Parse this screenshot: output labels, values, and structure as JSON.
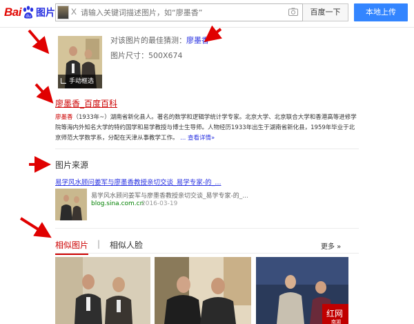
{
  "header": {
    "logo_bai": "Bai",
    "logo_tupian": "图片",
    "thumb_close": "X",
    "search_placeholder": "请输入关键词描述图片，如“廖墨香”",
    "search_button": "百度一下",
    "upload_button": "本地上传"
  },
  "guess": {
    "label": "对该图片的最佳猜测：",
    "keyword": "廖墨香",
    "size_label": "图片尺寸：500X674",
    "crop_label": "手动框选"
  },
  "baike": {
    "title": "廖墨香_百度百科",
    "desc_name": "廖墨香",
    "desc_body": "（1933年~）湖南省新化县人。著名的数学和逻辑学统计学专家。北京大学、北京联合大学和香港高等进修学院等海内外知名大学的特约国学和易学教授与博士生导师。人物经历1933年出生于湖南省新化县，1959年毕业于北京师范大学数学系，分配在天津从事教学工作。",
    "more": "... 查看详情»"
  },
  "source": {
    "section_title": "图片来源",
    "link": "易学风水顾问姜军与廖墨香教授亲切交谈_易学专家-的_...",
    "desc": "易学风水顾问姜军与廖墨香教授亲切交谈_易学专家-的_...",
    "domain": "blog.sina.com.cn",
    "date": "2016-03-19"
  },
  "similar": {
    "tab_similar": "相似图片",
    "tab_sep": "|",
    "tab_face": "相似人脸",
    "more": "更多 »",
    "stamp_text": "红网",
    "stamp_sub": "南湖"
  },
  "colors": {
    "accent_red": "#c00000",
    "link_blue": "#2932e1",
    "upload_blue": "#3385ff",
    "domain_green": "#008000"
  }
}
